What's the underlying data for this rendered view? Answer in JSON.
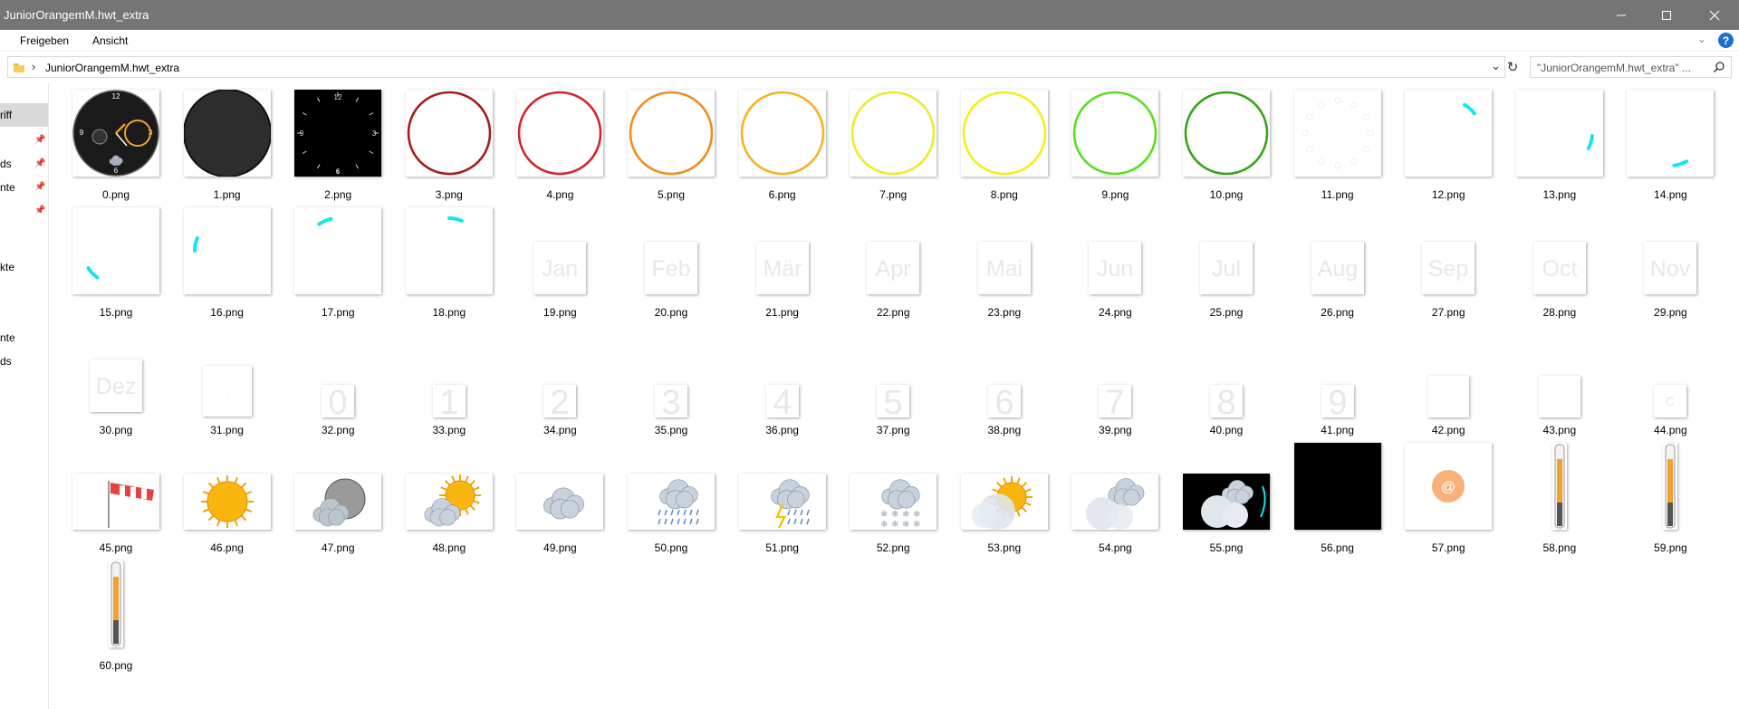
{
  "window": {
    "title": "JuniorOrangemM.hwt_extra",
    "minimize_icon": "minimize-icon",
    "maximize_icon": "maximize-icon",
    "close_icon": "close-icon"
  },
  "ribbon": {
    "tabs": [
      "Freigeben",
      "Ansicht"
    ],
    "help_label": "?"
  },
  "address": {
    "path": "JuniorOrangemM.hwt_extra",
    "search_placeholder": "\"JuniorOrangemM.hwt_extra\" ..."
  },
  "nav": {
    "items": [
      {
        "label": "riff",
        "pinned": false,
        "selected": true
      },
      {
        "label": "ds",
        "pinned": true,
        "selected": false
      },
      {
        "label": "nte",
        "pinned": true,
        "selected": false
      },
      {
        "label": "",
        "pinned": true,
        "selected": false
      },
      {
        "label": "kte",
        "pinned": false,
        "selected": false
      },
      {
        "label": "nte",
        "pinned": false,
        "selected": false
      },
      {
        "label": "ds",
        "pinned": false,
        "selected": false
      }
    ]
  },
  "files": [
    {
      "name": "0.png",
      "kind": "watchface"
    },
    {
      "name": "1.png",
      "kind": "dark"
    },
    {
      "name": "2.png",
      "kind": "blackdial"
    },
    {
      "name": "3.png",
      "kind": "ring",
      "color": "#a51c1c"
    },
    {
      "name": "4.png",
      "kind": "ring",
      "color": "#d8232a"
    },
    {
      "name": "5.png",
      "kind": "ring",
      "color": "#f28c1e"
    },
    {
      "name": "6.png",
      "kind": "ring",
      "color": "#f7b21c"
    },
    {
      "name": "7.png",
      "kind": "ring",
      "color": "#eeea2a"
    },
    {
      "name": "8.png",
      "kind": "ring",
      "color": "#f4ee1a"
    },
    {
      "name": "9.png",
      "kind": "ring",
      "color": "#56e01e"
    },
    {
      "name": "10.png",
      "kind": "ring",
      "color": "#36a317"
    },
    {
      "name": "11.png",
      "kind": "faintdial"
    },
    {
      "name": "12.png",
      "kind": "arc",
      "angle": 30
    },
    {
      "name": "13.png",
      "kind": "arc",
      "angle": 95
    },
    {
      "name": "14.png",
      "kind": "arc",
      "angle": 150
    },
    {
      "name": "15.png",
      "kind": "arc",
      "angle": 215
    },
    {
      "name": "16.png",
      "kind": "arc",
      "angle": 270
    },
    {
      "name": "17.png",
      "kind": "arc",
      "angle": 325
    },
    {
      "name": "18.png",
      "kind": "arc",
      "angle": 0
    },
    {
      "name": "19.png",
      "kind": "word",
      "text": "Jan"
    },
    {
      "name": "20.png",
      "kind": "word",
      "text": "Feb"
    },
    {
      "name": "21.png",
      "kind": "word",
      "text": "Mär"
    },
    {
      "name": "22.png",
      "kind": "word",
      "text": "Apr"
    },
    {
      "name": "23.png",
      "kind": "word",
      "text": "Mai"
    },
    {
      "name": "24.png",
      "kind": "word",
      "text": "Jun"
    },
    {
      "name": "25.png",
      "kind": "word",
      "text": "Jul"
    },
    {
      "name": "26.png",
      "kind": "word",
      "text": "Aug"
    },
    {
      "name": "27.png",
      "kind": "word",
      "text": "Sep"
    },
    {
      "name": "28.png",
      "kind": "word",
      "text": "Oct"
    },
    {
      "name": "29.png",
      "kind": "word",
      "text": "Nov"
    },
    {
      "name": "30.png",
      "kind": "word",
      "text": "Dez"
    },
    {
      "name": "31.png",
      "kind": "small",
      "text": "."
    },
    {
      "name": "32.png",
      "kind": "digit",
      "text": "0"
    },
    {
      "name": "33.png",
      "kind": "digit",
      "text": "1"
    },
    {
      "name": "34.png",
      "kind": "digit",
      "text": "2"
    },
    {
      "name": "35.png",
      "kind": "digit",
      "text": "3"
    },
    {
      "name": "36.png",
      "kind": "digit",
      "text": "4"
    },
    {
      "name": "37.png",
      "kind": "digit",
      "text": "5"
    },
    {
      "name": "38.png",
      "kind": "digit",
      "text": "6"
    },
    {
      "name": "39.png",
      "kind": "digit",
      "text": "7"
    },
    {
      "name": "40.png",
      "kind": "digit",
      "text": "8"
    },
    {
      "name": "41.png",
      "kind": "digit",
      "text": "9"
    },
    {
      "name": "42.png",
      "kind": "square"
    },
    {
      "name": "43.png",
      "kind": "square"
    },
    {
      "name": "44.png",
      "kind": "tiny",
      "text": "C"
    },
    {
      "name": "45.png",
      "kind": "windsock"
    },
    {
      "name": "46.png",
      "kind": "sun"
    },
    {
      "name": "47.png",
      "kind": "moon"
    },
    {
      "name": "48.png",
      "kind": "suncloud"
    },
    {
      "name": "49.png",
      "kind": "cloud"
    },
    {
      "name": "50.png",
      "kind": "rain"
    },
    {
      "name": "51.png",
      "kind": "storm"
    },
    {
      "name": "52.png",
      "kind": "snow"
    },
    {
      "name": "53.png",
      "kind": "fogsun"
    },
    {
      "name": "54.png",
      "kind": "fog"
    },
    {
      "name": "55.png",
      "kind": "blackcloud"
    },
    {
      "name": "56.png",
      "kind": "black"
    },
    {
      "name": "57.png",
      "kind": "at",
      "text": "@"
    },
    {
      "name": "58.png",
      "kind": "thermo"
    },
    {
      "name": "59.png",
      "kind": "thermo"
    },
    {
      "name": "60.png",
      "kind": "thermo"
    }
  ]
}
